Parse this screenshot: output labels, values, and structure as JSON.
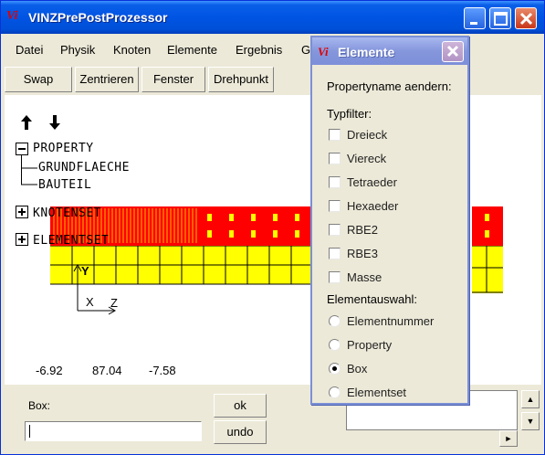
{
  "window": {
    "title": "VINZPrePostProzessor",
    "icon_glyph": "Vi"
  },
  "menu": [
    "Datei",
    "Physik",
    "Knoten",
    "Elemente",
    "Ergebnis",
    "G"
  ],
  "toolbar": [
    "Swap",
    "Zentrieren",
    "Fenster",
    "Drehpunkt"
  ],
  "tree": {
    "property": "PROPERTY",
    "children": [
      "GRUNDFLAECHE",
      "BAUTEIL"
    ],
    "knotenset": "KNOTENSET",
    "elementset": "ELEMENTSET"
  },
  "axes": {
    "y": "Y",
    "x": "X",
    "z": "Z"
  },
  "coords": [
    "-6.92",
    "87.04",
    "-7.58"
  ],
  "mesh_colors": {
    "red": "#ff0000",
    "yellow": "#ffff00"
  },
  "bottom": {
    "box_label": "Box:",
    "box_value": "",
    "ok": "ok",
    "undo": "undo"
  },
  "dialog": {
    "title": "Elemente",
    "rename": "Propertyname aendern:",
    "typfilter": "Typfilter:",
    "types": [
      "Dreieck",
      "Viereck",
      "Tetraeder",
      "Hexaeder",
      "RBE2",
      "RBE3",
      "Masse"
    ],
    "auswahl": "Elementauswahl:",
    "options": [
      "Elementnummer",
      "Property",
      "Box",
      "Elementset"
    ],
    "selected_option": "Box"
  }
}
